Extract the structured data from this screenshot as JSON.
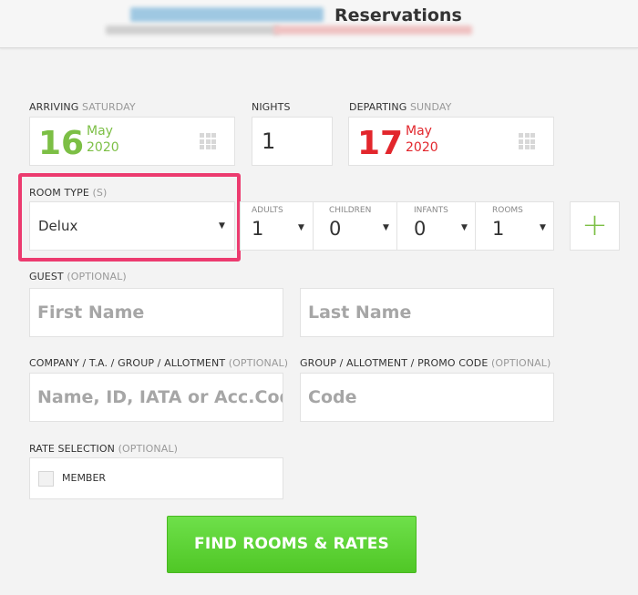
{
  "header": {
    "title": "Reservations"
  },
  "arriving": {
    "label": "ARRIVING",
    "weekday": "SATURDAY",
    "day": "16",
    "month": "May",
    "year": "2020"
  },
  "nights": {
    "label": "NIGHTS",
    "value": "1"
  },
  "departing": {
    "label": "DEPARTING",
    "weekday": "SUNDAY",
    "day": "17",
    "month": "May",
    "year": "2020"
  },
  "room_type": {
    "label": "ROOM TYPE",
    "suffix": "(S)",
    "value": "Delux"
  },
  "occupancy": {
    "adults_label": "ADULTS",
    "adults_value": "1",
    "children_label": "CHILDREN",
    "children_value": "0",
    "infants_label": "INFANTS",
    "infants_value": "0",
    "rooms_label": "ROOMS",
    "rooms_value": "1",
    "add_label": "+"
  },
  "guest": {
    "label": "GUEST",
    "optional": "(OPTIONAL)",
    "first_name_placeholder": "First Name",
    "last_name_placeholder": "Last Name"
  },
  "company": {
    "label": "COMPANY / T.A. / GROUP / ALLOTMENT",
    "optional": "(OPTIONAL)",
    "placeholder": "Name, ID, IATA or Acc.Code"
  },
  "promo": {
    "label": "GROUP / ALLOTMENT / PROMO CODE",
    "optional": "(OPTIONAL)",
    "placeholder": "Code"
  },
  "rate_selection": {
    "label": "RATE SELECTION",
    "optional": "(OPTIONAL)",
    "member_label": "MEMBER"
  },
  "find_button": {
    "label": "FIND ROOMS & RATES"
  },
  "colors": {
    "accent_green": "#7cbf45",
    "departure_red": "#e2262c",
    "highlight_pink": "#ec3b6f",
    "button_green": "#5ad232"
  }
}
